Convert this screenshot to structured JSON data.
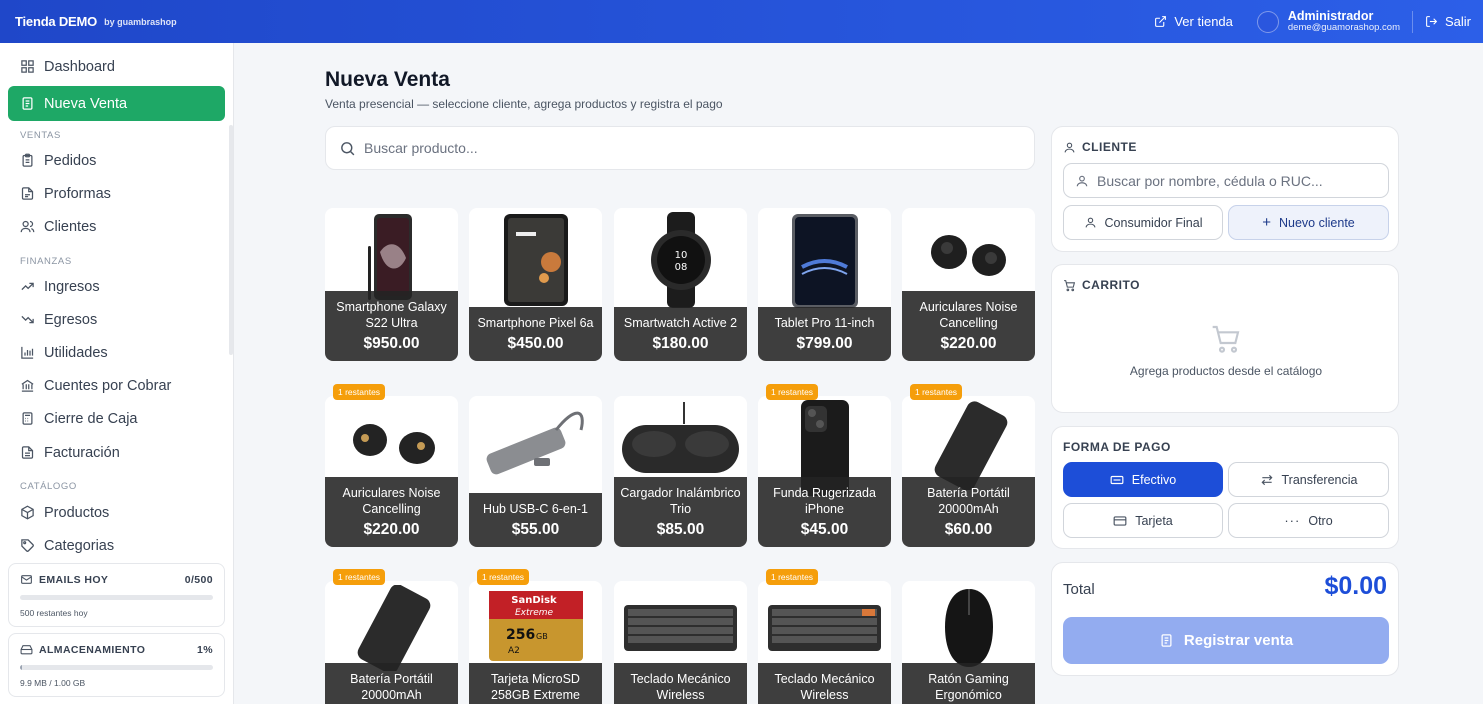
{
  "topbar": {
    "brand": "Tienda DEMO",
    "brand_by": "by guambrashop",
    "ver_tienda": "Ver tienda",
    "admin_name": "Administrador",
    "admin_email": "deme@guamorashop.com",
    "logout": "Salir"
  },
  "sidebar": {
    "top_items": [
      {
        "label": "Dashboard",
        "icon": "grid-icon"
      },
      {
        "label": "Nueva Venta",
        "icon": "receipt-icon",
        "active": true
      }
    ],
    "sections": [
      {
        "title": "VENTAS",
        "items": [
          {
            "label": "Pedidos",
            "icon": "clipboard-icon"
          },
          {
            "label": "Proformas",
            "icon": "document-icon"
          },
          {
            "label": "Clientes",
            "icon": "users-icon"
          }
        ]
      },
      {
        "title": "FINANZAS",
        "items": [
          {
            "label": "Ingresos",
            "icon": "trend-up-icon"
          },
          {
            "label": "Egresos",
            "icon": "trend-down-icon"
          },
          {
            "label": "Utilidades",
            "icon": "bar-chart-icon"
          },
          {
            "label": "Cuentes por Cobrar",
            "icon": "bank-icon"
          },
          {
            "label": "Cierre de Caja",
            "icon": "calculator-icon"
          },
          {
            "label": "Facturación",
            "icon": "invoice-icon"
          }
        ]
      },
      {
        "title": "CATÁLOGO",
        "items": [
          {
            "label": "Productos",
            "icon": "package-icon"
          },
          {
            "label": "Categorias",
            "icon": "tag-icon"
          }
        ]
      }
    ],
    "emails": {
      "title": "EMAILS HOY",
      "value": "0/500",
      "progress": 0,
      "footer": "500 restantes hoy"
    },
    "storage": {
      "title": "ALMACENAMIENTO",
      "value": "1%",
      "progress": 0.01,
      "footer": "9.9 MB / 1.00 GB"
    }
  },
  "main": {
    "title": "Nueva Venta",
    "subtitle": "Venta presencial — seleccione cliente, agrega productos y registra el pago",
    "search_placeholder": "Buscar producto..."
  },
  "products": [
    {
      "name": "Smartphone Galaxy S22 Ultra",
      "price": "$950.00",
      "badge": "",
      "image": "phone-galaxy"
    },
    {
      "name": "Smartphone Pixel 6a",
      "price": "$450.00",
      "badge": "",
      "image": "phone-pixel"
    },
    {
      "name": "Smartwatch Active 2",
      "price": "$180.00",
      "badge": "",
      "image": "watch"
    },
    {
      "name": "Tablet Pro 11-inch",
      "price": "$799.00",
      "badge": "",
      "image": "tablet"
    },
    {
      "name": "Auriculares Noise Cancelling",
      "price": "$220.00",
      "badge": "",
      "image": "earbuds-white"
    },
    {
      "name": "Auriculares Noise Cancelling",
      "price": "$220.00",
      "badge": "1 restantes",
      "image": "earbuds-black"
    },
    {
      "name": "Hub USB-C 6-en-1",
      "price": "$55.00",
      "badge": "",
      "image": "hub"
    },
    {
      "name": "Cargador Inalámbrico Trio",
      "price": "$85.00",
      "badge": "",
      "image": "charger"
    },
    {
      "name": "Funda Rugerizada iPhone",
      "price": "$45.00",
      "badge": "1 restantes",
      "image": "case"
    },
    {
      "name": "Batería Portátil 20000mAh",
      "price": "$60.00",
      "badge": "1 restantes",
      "image": "powerbank"
    },
    {
      "name": "Batería Portátil 20000mAh",
      "price": "",
      "badge": "1 restantes",
      "image": "powerbank"
    },
    {
      "name": "Tarjeta MicroSD 258GB Extreme",
      "price": "",
      "badge": "1 restantes",
      "image": "sdcard"
    },
    {
      "name": "Teclado Mecánico Wireless",
      "price": "",
      "badge": "",
      "image": "keyboard"
    },
    {
      "name": "Teclado Mecánico Wireless",
      "price": "",
      "badge": "1 restantes",
      "image": "keyboard"
    },
    {
      "name": "Ratón Gaming Ergonómico",
      "price": "",
      "badge": "",
      "image": "mouse"
    }
  ],
  "sdcard_print": {
    "brand": "SanDisk",
    "line": "Extreme",
    "capacity": "256",
    "suffix": "GB",
    "class": "A2"
  },
  "client": {
    "title": "CLIENTE",
    "search_placeholder": "Buscar por nombre, cédula o RUC...",
    "consumer": "Consumidor Final",
    "new": "Nuevo cliente"
  },
  "cart": {
    "title": "CARRITO",
    "empty": "Agrega productos desde el catálogo"
  },
  "payment": {
    "title": "FORMA DE PAGO",
    "options": [
      {
        "label": "Efectivo",
        "icon": "cash-icon",
        "selected": true
      },
      {
        "label": "Transferencia",
        "icon": "transfer-icon"
      },
      {
        "label": "Tarjeta",
        "icon": "card-icon"
      },
      {
        "label": "Otro",
        "icon": "dots-icon"
      }
    ]
  },
  "total": {
    "label": "Total",
    "value": "$0.00",
    "register": "Registrar venta"
  },
  "colors": {
    "topbar": "#2148d4",
    "active_nav": "#1ea866",
    "accent": "#1d4ed8",
    "badge": "#f59e0b",
    "register_disabled": "#93acf0"
  }
}
